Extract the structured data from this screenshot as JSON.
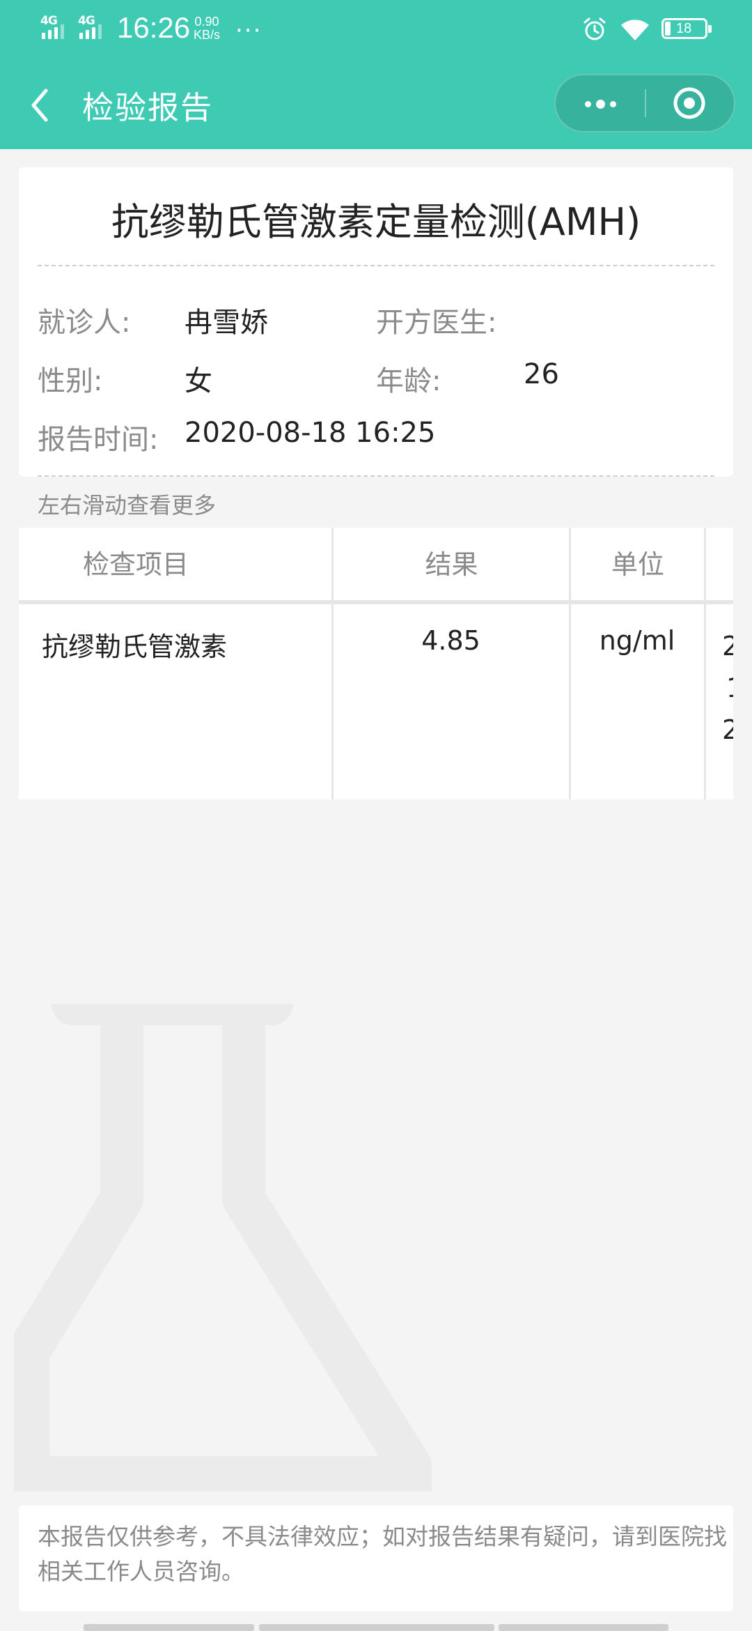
{
  "status_bar": {
    "network1": "4G",
    "network2": "4G",
    "time": "16:26",
    "speed_value": "0.90",
    "speed_unit": "KB/s",
    "more": "···",
    "battery": "18",
    "icons": [
      "alarm-icon",
      "wifi-icon",
      "battery-icon"
    ]
  },
  "nav": {
    "title": "检验报告",
    "back_icon": "chevron-left-icon",
    "more_icon": "more-dots-icon",
    "close_icon": "target-circle-icon"
  },
  "report": {
    "title": "抗缪勒氏管激素定量检测(AMH)",
    "patient_label": "就诊人:",
    "patient_value": "冉雪娇",
    "doctor_label": "开方医生:",
    "doctor_value": "",
    "gender_label": "性别:",
    "gender_value": "女",
    "age_label": "年龄:",
    "age_value": "26",
    "time_label": "报告时间:",
    "time_value": "2020-08-18 16:25"
  },
  "scroll_hint": "左右滑动查看更多",
  "table": {
    "headers": [
      "检查项目",
      "结果",
      "单位"
    ],
    "rows": [
      {
        "item": "抗缪勒氏管激素",
        "result": "4.85",
        "unit": "ng/ml",
        "truncated": [
          "2",
          "1",
          "2"
        ]
      }
    ]
  },
  "watermark_icon": "flask-icon",
  "footer": {
    "disclaimer": "本报告仅供参考，不具法律效应；如对报告结果有疑问，请到医院找相关工作人员咨询。"
  },
  "colors": {
    "brand": "#3fcbb3",
    "background": "#f4f4f4",
    "muted_text": "#8a8a8a"
  }
}
